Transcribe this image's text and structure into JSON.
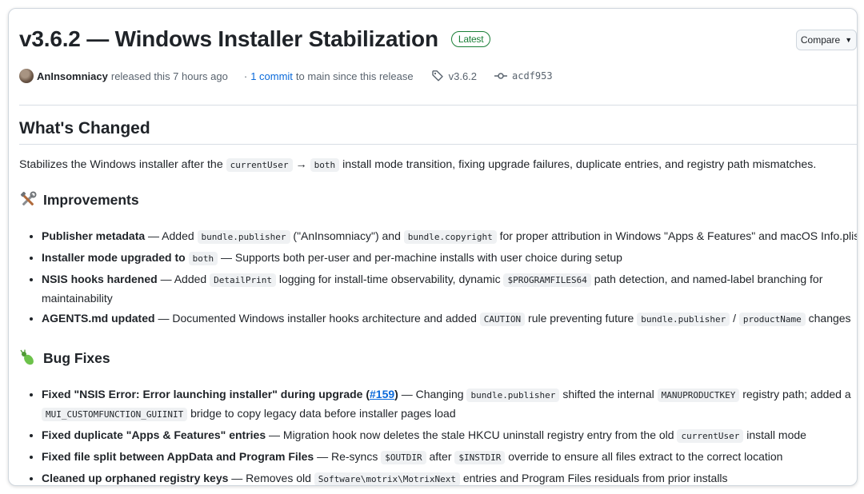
{
  "release": {
    "title": "v3.6.2 — Windows Installer Stabilization",
    "badge": "Latest",
    "compare_label": "Compare",
    "author": "AnInsomniacy",
    "released_text": "released this 7 hours ago",
    "commit_link": "1 commit",
    "commit_suffix": "to main since this release",
    "tag": "v3.6.2",
    "commit_hash": "acdf953"
  },
  "body": {
    "heading": "What's Changed",
    "intro": {
      "p1": "Stabilizes the Windows installer after the",
      "c1": "currentUser",
      "arrow": "→",
      "c2": "both",
      "p2": "install mode transition, fixing upgrade failures, duplicate entries, and registry path mismatches."
    },
    "improvements": {
      "heading": "Improvements",
      "items": [
        {
          "b": "Publisher metadata",
          "t1": "— Added",
          "c1": "bundle.publisher",
          "t2": "(\"AnInsomniacy\") and",
          "c2": "bundle.copyright",
          "t3": "for proper attribution in Windows \"Apps & Features\" and macOS Info.plist"
        },
        {
          "b": "Installer mode upgraded to",
          "c1": "both",
          "t1": "— Supports both per-user and per-machine installs with user choice during setup"
        },
        {
          "b": "NSIS hooks hardened",
          "t1": "— Added",
          "c1": "DetailPrint",
          "t2": "logging for install-time observability, dynamic",
          "c2": "$PROGRAMFILES64",
          "t3": "path detection, and named-label branching for maintainability"
        },
        {
          "b": "AGENTS.md updated",
          "t1": "— Documented Windows installer hooks architecture and added",
          "c1": "CAUTION",
          "t2": "rule preventing future",
          "c2": "bundle.publisher",
          "t3": "/",
          "c3": "productName",
          "t4": "changes"
        }
      ]
    },
    "bugfixes": {
      "heading": "Bug Fixes",
      "items": [
        {
          "b": "Fixed \"NSIS Error: Error launching installer\" during upgrade",
          "pre": "(",
          "issue": "#159",
          "post": ")",
          "t1": "— Changing",
          "c1": "bundle.publisher",
          "t2": "shifted the internal",
          "c2": "MANUPRODUCTKEY",
          "t3": "registry path; added a",
          "c3": "MUI_CUSTOMFUNCTION_GUIINIT",
          "t4": "bridge to copy legacy data before installer pages load"
        },
        {
          "b": "Fixed duplicate \"Apps & Features\" entries",
          "t1": "— Migration hook now deletes the stale HKCU uninstall registry entry from the old",
          "c1": "currentUser",
          "t2": "install mode"
        },
        {
          "b": "Fixed file split between AppData and Program Files",
          "t1": "— Re-syncs",
          "c1": "$OUTDIR",
          "t2": "after",
          "c2": "$INSTDIR",
          "t3": "override to ensure all files extract to the correct location"
        },
        {
          "b": "Cleaned up orphaned registry keys",
          "t1": "— Removes old",
          "c1": "Software\\motrix\\MotrixNext",
          "t2": "entries and Program Files residuals from prior installs"
        }
      ]
    }
  },
  "colors": {
    "accent_link": "#0969da",
    "latest_green": "#1a7f37",
    "code_bg": "#eff1f3"
  },
  "icons": [
    "avatar",
    "tag-icon",
    "commit-icon",
    "tools-emoji-icon",
    "bug-emoji-icon",
    "caret-down-icon"
  ]
}
